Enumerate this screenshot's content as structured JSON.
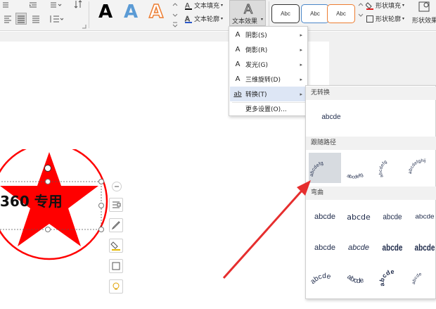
{
  "ribbon": {
    "font_effects": {
      "list_icon": "list-icon",
      "sort_icon": "sort-icon"
    },
    "art_styles": [
      {
        "letter": "A",
        "fill": "#000000",
        "stroke": "none"
      },
      {
        "letter": "A",
        "fill": "#5b9bd5",
        "stroke": "none"
      },
      {
        "letter": "A",
        "fill": "#ffffff",
        "stroke": "#ed7d31"
      }
    ],
    "text_fill_label": "文本填充",
    "text_outline_label": "文本轮廓",
    "text_effect_label": "文本效果",
    "style_buttons": [
      {
        "label": "Abc",
        "border": "#333333"
      },
      {
        "label": "Abc",
        "border": "#4a86c8"
      },
      {
        "label": "Abc",
        "border": "#ed7d31"
      }
    ],
    "shape_fill_label": "形状填充",
    "shape_outline_label": "形状轮廓",
    "shape_effect_label": "形状效果"
  },
  "effect_menu": {
    "items": [
      {
        "icon": "A",
        "label": "阴影(S)",
        "submenu": true
      },
      {
        "icon": "A",
        "label": "倒影(R)",
        "submenu": true
      },
      {
        "icon": "A",
        "label": "发光(G)",
        "submenu": true
      },
      {
        "icon": "A",
        "label": "三维旋转(D)",
        "submenu": true
      },
      {
        "icon": "ab",
        "label": "转换(T)",
        "submenu": true
      },
      {
        "icon": "",
        "label": "更多设置(O)...",
        "submenu": false
      }
    ]
  },
  "transform_submenu": {
    "no_transform_header": "无转换",
    "no_transform_sample": "abcde",
    "follow_path_header": "跟随路径",
    "follow_path_samples": [
      "abcdefg",
      "abcdefg",
      "abcdefg",
      "abcdefghij"
    ],
    "warp_header": "弯曲",
    "warp_samples": [
      "abcde",
      "abcde",
      "abcde",
      "abcde",
      "abcde",
      "abcde",
      "abcde",
      "abcde",
      "abcde",
      "abcde",
      "abcde",
      "abcde"
    ]
  },
  "document": {
    "stamp_text": "360 专用",
    "stamp_color": "#ff0000"
  },
  "accent_color": "#e62e2e"
}
